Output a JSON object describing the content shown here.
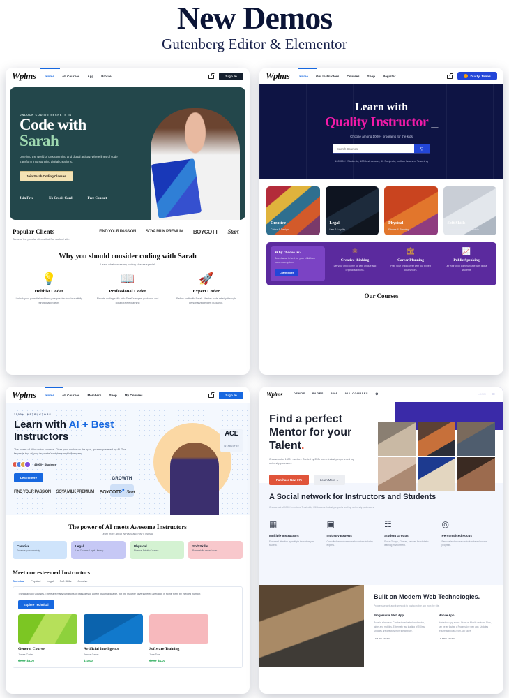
{
  "header": {
    "title": "New Demos",
    "subtitle": "Gutenberg Editor & Elementor"
  },
  "panel1": {
    "logo": "Wplms",
    "nav": [
      "Home",
      "All Courses",
      "App",
      "Profile"
    ],
    "cart_icon": "cart-icon",
    "signin": "Sign In",
    "hero": {
      "eyebrow": "UNLOCK CODING SECRETS IN",
      "title_line1": "Code with",
      "title_line2": "Sarah",
      "body": "Dive into the world of programming and digital artistry, where lines of code transform into stunning digital creations.",
      "cta": "Join Sarah Coding Classes",
      "features": [
        "Join Free",
        "No Credit Card",
        "Free Consult"
      ]
    },
    "clients": {
      "title": "Popular Clients",
      "subtitle": "Some of the popular clients that I've worked with",
      "logos": [
        "FIND YOUR PASSION",
        "SOYA MILK PREMIUM",
        "BOYCOTT",
        "Start"
      ]
    },
    "why": {
      "title": "Why you should consider coding with Sarah",
      "subtitle": "Learn what makes my coding classes special",
      "cards": [
        {
          "icon": "lightbulb-icon",
          "glyph": "💡",
          "title": "Hobbist Coder",
          "text": "Unlock your potential and turn your passion into beautifully functional projects"
        },
        {
          "icon": "open-book-icon",
          "glyph": "📖",
          "title": "Professional Coder",
          "text": "Elevate coding skills with Sarah's expert guidance and collaborative learning"
        },
        {
          "icon": "rocket-icon",
          "glyph": "🚀",
          "title": "Expert Coder",
          "text": "Refine craft with Sarah. Master code artistry through personalized expert guidance."
        }
      ]
    }
  },
  "panel2": {
    "logo": "Wplms",
    "nav": [
      "Home",
      "Our Instructors",
      "Courses",
      "Shop",
      "Register"
    ],
    "cart_icon": "cart-icon",
    "user_badge": "Dusty Jonas",
    "hero": {
      "title_line1": "Learn with",
      "title_line2": "Quality Instructor",
      "subtitle": "Choose among 1000+ programs for the kids",
      "search_placeholder": "Search Courses",
      "search_icon": "search-icon",
      "stats": "100,000+ Students, 100 Instructors , 50 Subjects, lmillion hours of Teaching"
    },
    "categories": [
      {
        "title": "Creative",
        "subtitle": "Colors & Design"
      },
      {
        "title": "Legal",
        "subtitle": "Law & Loyalty"
      },
      {
        "title": "Physical",
        "subtitle": "Fitness & Running"
      },
      {
        "title": "Soft Skills",
        "subtitle": "Communication and Confide"
      }
    ],
    "why": {
      "title": "Why choose us?",
      "text": "Select what is best for your child from numerous options",
      "cta": "Learn More",
      "items": [
        {
          "icon": "atom-icon",
          "glyph": "⚛",
          "title": "Creative thinking",
          "text": "Let your child come up with unique and original solutions."
        },
        {
          "icon": "bank-icon",
          "glyph": "🏛",
          "title": "Career Planning",
          "text": "Plan your child career with our expert counsellors."
        },
        {
          "icon": "chart-icon",
          "glyph": "📈",
          "title": "Public Speaking",
          "text": "Let your child communicate with global students"
        }
      ]
    },
    "courses_title": "Our Courses"
  },
  "panel3": {
    "logo": "Wplms",
    "nav": [
      "Home",
      "All Courses",
      "Members",
      "Shop",
      "My Courses"
    ],
    "cart_icon": "cart-icon",
    "signin": "Sign In",
    "hero": {
      "eyebrow": "1100+ INSTRUCTORS",
      "title_pre": "Learn with ",
      "title_accent": "AI + Best",
      "title_post": "Instructors",
      "body": "The power of AI in online courses. Clear your doubts on the spot, quizzes powered by AI. The favourite tool of your favourite Youtubers and influencers.",
      "students": "44000+ Students",
      "cta": "Learn more",
      "ace_badge": "ACE",
      "ace_sub": "INSTRUCTOR",
      "growth_badge": "GROWTH",
      "growth_icon": "trending-up-icon"
    },
    "ai_section": {
      "title": "The power of AI meets Awesome Instructors",
      "subtitle": "Learn more about WPLMS and how it uses AI",
      "pills": [
        {
          "title": "Creative",
          "text": "Enhance your creativity",
          "color": "#cfe4fb"
        },
        {
          "title": "Legal",
          "text": "Law Courses, Legal Literacy",
          "color": "#c6c8f5"
        },
        {
          "title": "Physical",
          "text": "Physical Activity Courses",
          "color": "#d4f2d2"
        },
        {
          "title": "Soft Skills",
          "text": "Power skills ranked soon",
          "color": "#f8c8cc"
        }
      ]
    },
    "instructors": {
      "title": "Meet our esteemed Instructors",
      "tabs": [
        "Technical",
        "Physical",
        "Legal",
        "Soft Skills",
        "Creative"
      ],
      "body": "Technical Skill Courses. There are many variations of passages of Lorem Ipsum available, but the majority have suffered alteration in some form, by injected humour.",
      "cta": "Explore Technical",
      "courses": [
        {
          "title": "General Course",
          "author": "James Carter",
          "price_old": "$9.99",
          "price": "$3.00",
          "color": "#8ed13c"
        },
        {
          "title": "Artificial Intelligence",
          "author": "James Carter",
          "price_old": "",
          "price": "$10.00",
          "color": "#1071c0"
        },
        {
          "title": "Software Training",
          "author": "Jane Doe",
          "price_old": "$9.99",
          "price": "$1.00",
          "color": "#f7b9bd"
        }
      ]
    }
  },
  "panel4": {
    "logo": "Wplms",
    "nav": [
      "DEMOS",
      "PAGES",
      "PWA",
      "ALL COURSES"
    ],
    "search_icon": "search-icon",
    "login": "LOGIN",
    "menu_icon": "hamburger-menu-icon",
    "hero": {
      "title_line1": "Find a perfect",
      "title_line2": "Mentor for your",
      "title_line3": "Talent",
      "body": "Choose out of 1500+ mentors. Trusted by 250k users. Industry experts and top university professors.",
      "buy": "Purchase Now $75",
      "more": "Learn More →"
    },
    "social": {
      "title": "A Social network for Instructors and Students",
      "subtitle": "Choose out of 1500+ mentors. Trusted by 250k users. Industry experts and top university professors.",
      "features": [
        {
          "icon": "instructors-icon",
          "glyph": "▦",
          "title": "Multiple Instructors",
          "text": "Focussed attention by multiple instructors per student."
        },
        {
          "icon": "presentation-icon",
          "glyph": "▣",
          "title": "Industry Experts",
          "text": "Consulted on real seminars by various industry experts."
        },
        {
          "icon": "group-icon",
          "glyph": "☷",
          "title": "Student Groups",
          "text": "Social Groups, Classes, batches for wholistic learning environment."
        },
        {
          "icon": "target-icon",
          "glyph": "◎",
          "title": "Personalised Focus",
          "text": "Personalised course curriculum based on user progress."
        }
      ]
    },
    "tech": {
      "title": "Built on Modern Web Technologies.",
      "subtitle": "Progressive web app framework to host a mobile app from the site.",
      "columns": [
        {
          "title": "Progressive Web App",
          "text": "Runs in a browser. Can be downloaded on desktop, tablet and mobiles. Extremely fast loading of 200ms. Updates are directory from the website.",
          "link": "LEARN MORE"
        },
        {
          "title": "Mobile App",
          "text": "Hosted on App stores. Runs on Mobile devices. Slow, can be as fast as a Progressive web app. Updates require approvals from App store.",
          "link": "LEARN MORE"
        }
      ]
    }
  }
}
